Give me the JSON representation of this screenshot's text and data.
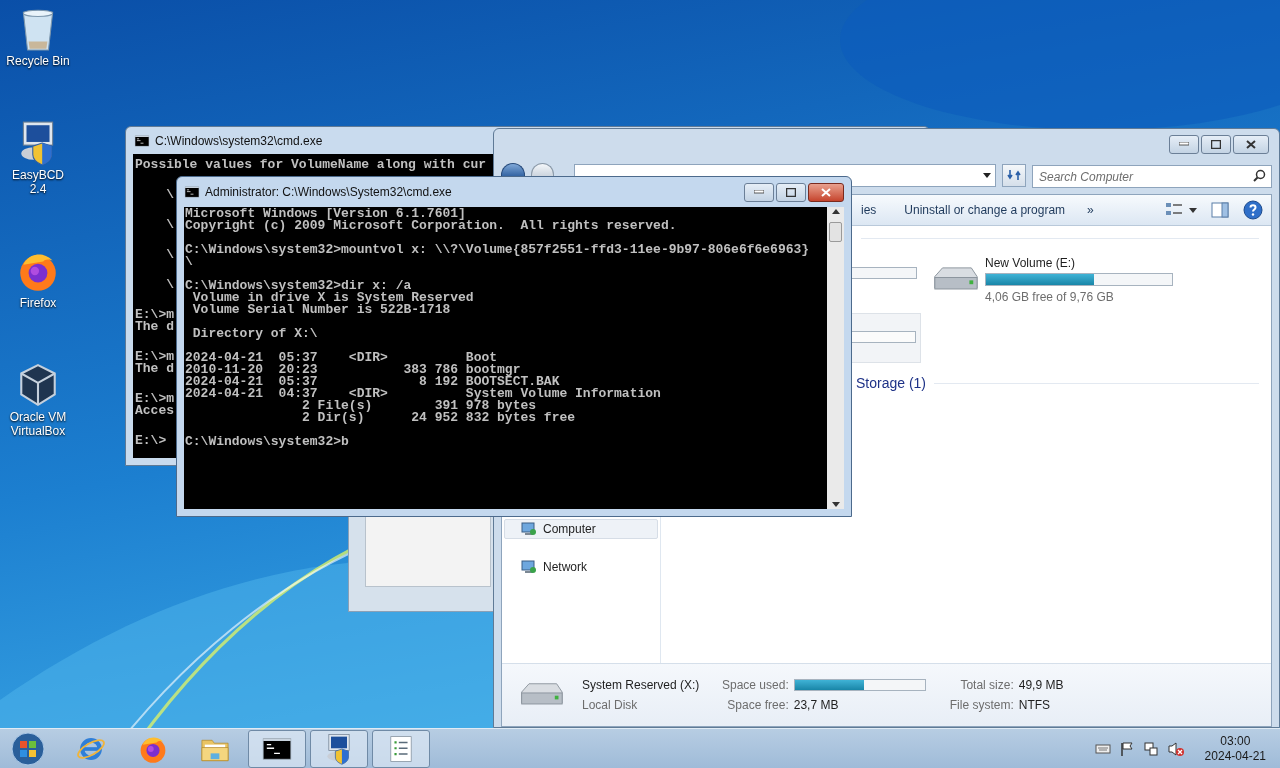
{
  "desktop_icons": [
    {
      "kind": "recycle-bin",
      "label": "Recycle Bin"
    },
    {
      "kind": "easybcd",
      "label": "EasyBCD 2.4"
    },
    {
      "kind": "firefox",
      "label": "Firefox"
    },
    {
      "kind": "virtualbox",
      "label": "Oracle VM VirtualBox"
    }
  ],
  "back_console": {
    "title": "C:\\Windows\\system32\\cmd.exe",
    "blocks": [
      [
        "Possible values for VolumeName along with cur"
      ],
      [
        "    \\"
      ],
      [
        "    \\"
      ],
      [
        "    \\"
      ],
      [
        "    \\"
      ],
      [
        "E:\\>m",
        "The d"
      ],
      [
        "E:\\>m",
        "The d"
      ],
      [
        "E:\\>m",
        "Acces"
      ],
      [
        "E:\\>"
      ]
    ]
  },
  "explorer": {
    "search": {
      "placeholder": "Search Computer"
    },
    "toolbar": [
      "ies",
      "Uninstall or change a program",
      "»"
    ],
    "drives": [
      {
        "name": "New Volume (E:)",
        "level": 0.58,
        "free": "4,06 GB free of 9,76 GB"
      }
    ],
    "group_heading": "Storage (1)",
    "nav": [
      {
        "label": "Computer",
        "selected": true
      },
      {
        "label": "Network",
        "selected": false
      }
    ],
    "details": {
      "name": "System Reserved (X:)",
      "type": "Local Disk",
      "used_label": "Space used:",
      "level": 0.53,
      "free_label": "Space free:",
      "free": "23,7 MB",
      "total_label": "Total size:",
      "total": "49,9 MB",
      "fs_label": "File system:",
      "fs": "NTFS"
    }
  },
  "console": {
    "title": "Administrator: C:\\Windows\\System32\\cmd.exe",
    "blocks": [
      [
        "Microsoft Windows [Version 6.1.7601]",
        "Copyright (c) 2009 Microsoft Corporation.  All rights reserved."
      ],
      [
        "C:\\Windows\\system32>mountvol x: \\\\?\\Volume{857f2551-ffd3-11ee-9b97-806e6f6e6963}",
        "\\"
      ],
      [
        "C:\\Windows\\system32>dir x: /a",
        " Volume in drive X is System Reserved",
        " Volume Serial Number is 522B-1718"
      ],
      [
        " Directory of X:\\"
      ],
      [
        "2024-04-21  05:37    <DIR>          Boot",
        "2010-11-20  20:23           383 786 bootmgr",
        "2024-04-21  05:37             8 192 BOOTSECT.BAK",
        "2024-04-21  04:37    <DIR>          System Volume Information",
        "               2 File(s)        391 978 bytes",
        "               2 Dir(s)      24 952 832 bytes free"
      ],
      [
        "C:\\Windows\\system32>b"
      ]
    ]
  },
  "taskbar": {
    "items": [
      {
        "kind": "ie",
        "running": false
      },
      {
        "kind": "firefox",
        "running": false
      },
      {
        "kind": "folder",
        "running": false
      },
      {
        "kind": "cmd",
        "running": true
      },
      {
        "kind": "easybcd",
        "running": true
      },
      {
        "kind": "list",
        "running": true
      }
    ],
    "clock": {
      "time": "03:00",
      "date": "2024-04-21"
    }
  }
}
